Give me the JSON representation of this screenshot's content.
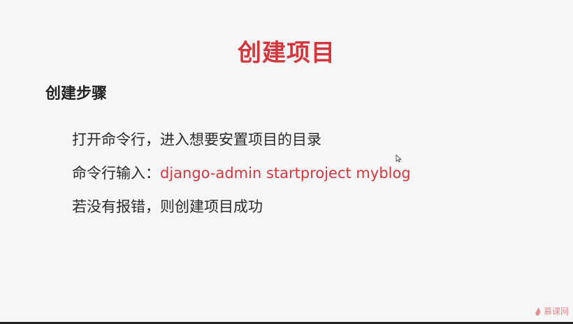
{
  "slide": {
    "title": "创建项目",
    "subtitle": "创建步骤",
    "steps": [
      "打开命令行，进入想要安置项目的目录",
      "命令行输入：",
      "若没有报错，则创建项目成功"
    ],
    "command": "django-admin startproject myblog"
  },
  "watermark": {
    "text": "慕课网",
    "icon": "flame-icon"
  },
  "colors": {
    "accent": "#d0383f",
    "text": "#2a2a2a",
    "background": "#f6f6f6"
  }
}
